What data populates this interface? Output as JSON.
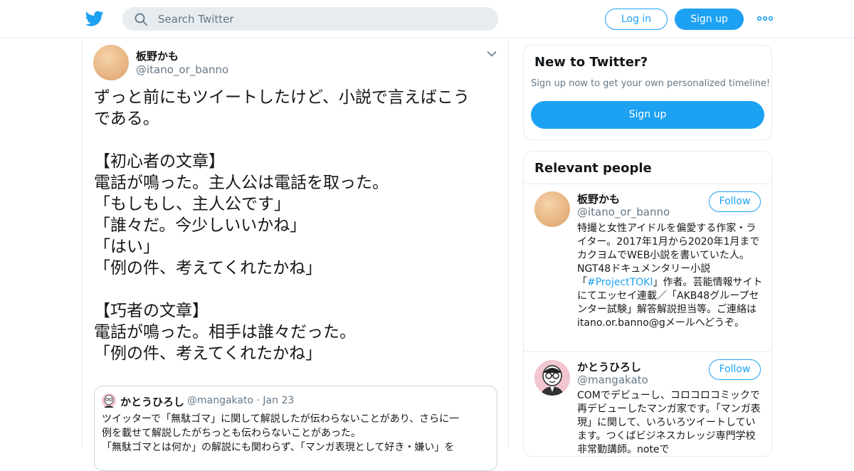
{
  "header": {
    "logo_icon": "twitter-bird-icon",
    "search_placeholder": "Search Twitter",
    "login_label": "Log in",
    "signup_label": "Sign up",
    "more_icon": "more-dots-icon",
    "accent_color": "#1da1f2"
  },
  "tweet": {
    "author_name": "板野かも",
    "author_handle": "@itano_or_banno",
    "text": "ずっと前にもツイートしたけど、小説で言えばこう\nである。\n\n【初心者の文章】\n電話が鳴った。主人公は電話を取った。\n「もしもし、主人公です」\n「誰々だ。今少しいいかね」\n「はい」\n「例の件、考えてくれたかね」\n\n【巧者の文章】\n電話が鳴った。相手は誰々だった。\n「例の件、考えてくれたかね」",
    "quote": {
      "author_name": "かとうひろし",
      "author_handle": "@mangakato",
      "date": "Jan 23",
      "text": "ツイッターで「無駄ゴマ」に関して解説したが伝わらないことがあり、さらに一\n例を載せて解説したがちっとも伝わらないことがあった。\n「無駄ゴマとは何か」の解説にも関わらず、「マンガ表現として好き・嫌い」を"
    }
  },
  "sidebar": {
    "new_to_twitter": {
      "title": "New to Twitter?",
      "subtitle": "Sign up now to get your own personalized timeline!",
      "button_label": "Sign up"
    },
    "relevant_people": {
      "title": "Relevant people",
      "people": [
        {
          "name": "板野かも",
          "handle": "@itano_or_banno",
          "follow_label": "Follow",
          "bio_before": "特撮と女性アイドルを偏愛する作家・ライター。2017年1月から2020年1月までカクヨムでWEB小説を書いていた人。NGT48ドキュメンタリー小説「",
          "bio_link": "#ProjectTOKI",
          "bio_after": "」作者。芸能情報サイトにてエッセイ連載／「AKB48グループセンター試験」解答解説担当等。ご連絡はitano.or.banno@gメールへどうぞ。"
        },
        {
          "name": "かとうひろし",
          "handle": "@mangakato",
          "follow_label": "Follow",
          "bio": "COMでデビューし、コロコロコミックで再デビューしたマンガ家です。「マンガ表現」に関して、いろいろツイートしています。つくばビジネスカレッジ専門学校非常勤講師。noteで"
        }
      ]
    }
  }
}
